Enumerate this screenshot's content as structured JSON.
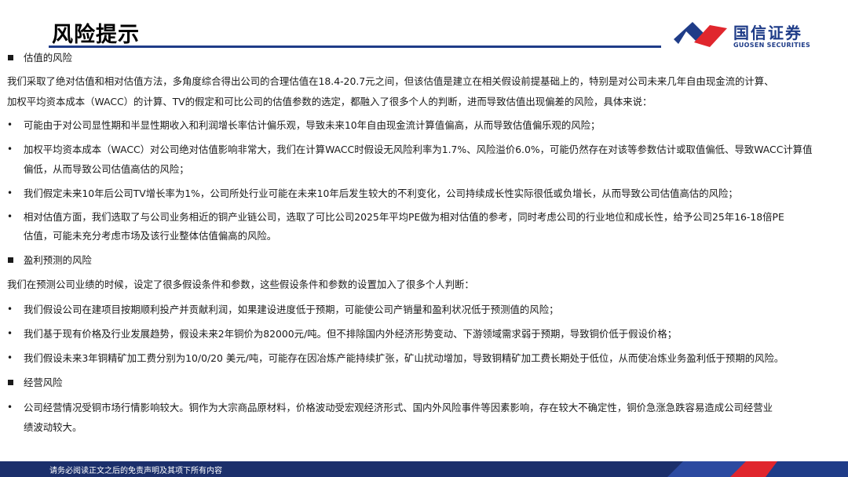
{
  "header": {
    "title": "风险提示",
    "logo_cn": "国信证券",
    "logo_en": "GUOSEN SECURITIES"
  },
  "sections": [
    {
      "heading": "估值的风险",
      "intro": [
        "我们采取了绝对估值和相对估值方法，多角度综合得出公司的合理估值在18.4-20.7元之间，但该估值是建立在相关假设前提基础上的，特别是对公司未来几年自由现金流的计算、",
        "加权平均资本成本（WACC）的计算、TV的假定和可比公司的估值参数的选定，都融入了很多个人的判断，进而导致估值出现偏差的风险，具体来说："
      ],
      "bullets": [
        [
          "可能由于对公司显性期和半显性期收入和利润增长率估计偏乐观，导致未来10年自由现金流计算值偏高，从而导致估值偏乐观的风险；"
        ],
        [
          "加权平均资本成本（WACC）对公司绝对估值影响非常大，我们在计算WACC时假设无风险利率为1.7%、风险溢价6.0%，可能仍然存在对该等参数估计或取值偏低、导致WACC计算值",
          "偏低，从而导致公司估值高估的风险；"
        ],
        [
          "我们假定未来10年后公司TV增长率为1%，公司所处行业可能在未来10年后发生较大的不利变化，公司持续成长性实际很低或负增长，从而导致公司估值高估的风险；"
        ],
        [
          "相对估值方面，我们选取了与公司业务相近的铜产业链公司，选取了可比公司2025年平均PE做为相对估值的参考，同时考虑公司的行业地位和成长性，给予公司25年16-18倍PE",
          "估值，可能未充分考虑市场及该行业整体估值偏高的风险。"
        ]
      ]
    },
    {
      "heading": "盈利预测的风险",
      "intro": [
        "我们在预测公司业绩的时候，设定了很多假设条件和参数，这些假设条件和参数的设置加入了很多个人判断："
      ],
      "bullets": [
        [
          "我们假设公司在建项目按期顺利投产并贡献利润，如果建设进度低于预期，可能使公司产销量和盈利状况低于预测值的风险；"
        ],
        [
          "我们基于现有价格及行业发展趋势，假设未来2年铜价为82000元/吨。但不排除国内外经济形势变动、下游领域需求弱于预期，导致铜价低于假设价格；"
        ],
        [
          "我们假设未来3年铜精矿加工费分别为10/0/20 美元/吨，可能存在因冶炼产能持续扩张，矿山扰动增加，导致铜精矿加工费长期处于低位，从而使冶炼业务盈利低于预期的风险。"
        ]
      ]
    },
    {
      "heading": "经营风险",
      "intro": [],
      "bullets": [
        [
          "公司经营情况受铜市场行情影响较大。铜作为大宗商品原材料，价格波动受宏观经济形式、国内外风险事件等因素影响，存在较大不确定性，铜价急涨急跌容易造成公司经营业",
          "绩波动较大。"
        ]
      ]
    }
  ],
  "footer": {
    "disclaimer": "请务必阅读正文之后的免责声明及其项下所有内容"
  },
  "colors": {
    "brand_blue": "#1f3c88",
    "brand_red": "#e0262d",
    "footer_dark": "#1b2f6b"
  }
}
